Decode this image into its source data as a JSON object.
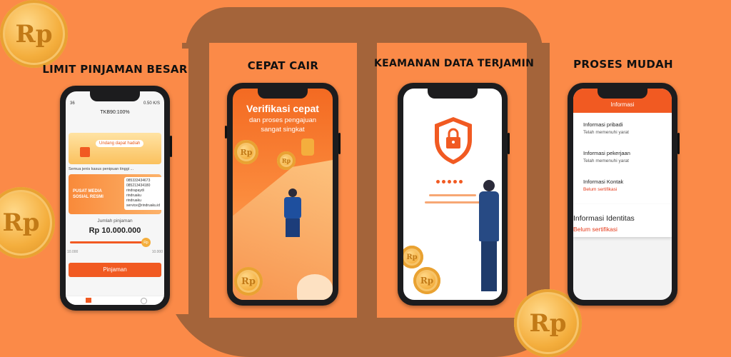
{
  "features": [
    {
      "title": "LIMIT PINJAMAN BESAR"
    },
    {
      "title": "CEPAT CAIR"
    },
    {
      "title": "KEAMANAN DATA TERJAMIN"
    },
    {
      "title": "PROSES MUDAH"
    }
  ],
  "coin_label": "Rp",
  "screen1": {
    "status_left": "36",
    "status_right": "0.50 K/S",
    "header": "TKB90:100%",
    "banner": "Undang dapat hadiah",
    "notice": "Semua jenis kasus penipuan tinggi ...",
    "promo_title": "PUSAT MEDIA SOSIAL RESMI",
    "contacts": [
      "085333434673",
      "085213434180",
      "rindrapaydi",
      "rindruaku",
      "rindruaku",
      "service@rindruaku.id"
    ],
    "amount_label": "Jumlah pinjaman",
    "amount": "Rp 10.000.000",
    "slider_knob": "Rp",
    "range_min": "10.000",
    "range_max": "10.000",
    "cta": "Pinjaman",
    "slider_fraction": 1.0
  },
  "screen2": {
    "headline": "Verifikasi cepat",
    "subtitle": "dan proses pengajuan sangat singkat"
  },
  "screen4": {
    "header": "Informasi",
    "items": [
      {
        "title": "Informasi pribadi",
        "status": "Telah memenuhi yarat"
      },
      {
        "title": "Informasi pekerjaan",
        "status": "Telah memenuhi yarat"
      },
      {
        "title": "Informasi Kontak",
        "status": "Belum sertifikasi"
      }
    ],
    "identity_title": "Informasi Identitas",
    "identity_status": "Belum sertifikasi"
  },
  "colors": {
    "background": "#fb8a48",
    "accent": "#f15a22",
    "brown": "#a4643a",
    "gold": "#f4ae3d"
  }
}
